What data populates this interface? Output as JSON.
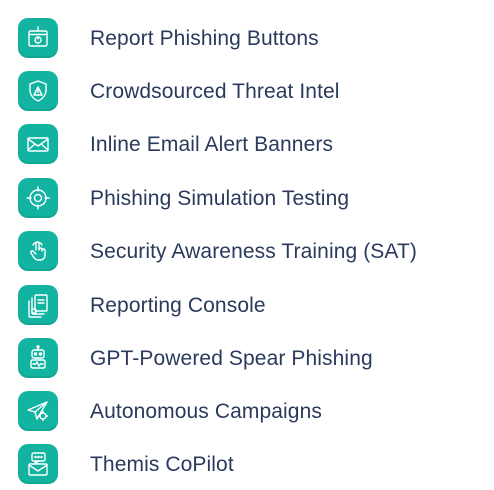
{
  "features": [
    {
      "label": "Report Phishing Buttons",
      "icon": "report-button-icon"
    },
    {
      "label": "Crowdsourced Threat Intel",
      "icon": "shield-alert-icon"
    },
    {
      "label": "Inline Email Alert Banners",
      "icon": "envelope-icon"
    },
    {
      "label": "Phishing Simulation Testing",
      "icon": "target-icon"
    },
    {
      "label": "Security Awareness Training (SAT)",
      "icon": "pointer-hand-icon"
    },
    {
      "label": "Reporting Console",
      "icon": "document-stack-icon"
    },
    {
      "label": "GPT-Powered Spear Phishing",
      "icon": "robot-icon"
    },
    {
      "label": "Autonomous Campaigns",
      "icon": "paper-plane-gear-icon"
    },
    {
      "label": "Themis CoPilot",
      "icon": "chat-envelope-icon"
    }
  ],
  "colors": {
    "icon_background": "#12b3a0",
    "icon_stroke": "#ffffff",
    "label_text": "#2a3a5c"
  }
}
